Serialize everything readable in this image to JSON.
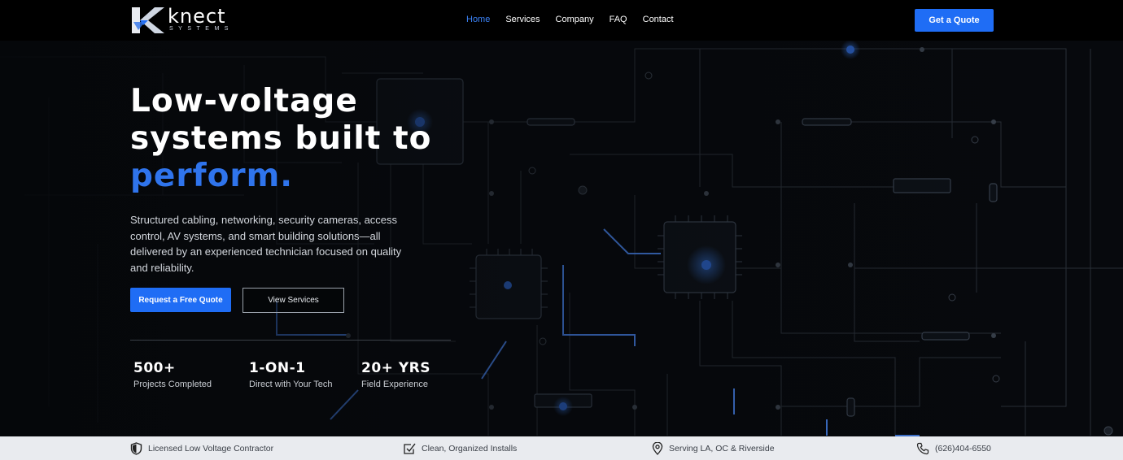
{
  "brand": {
    "name": "knect",
    "subtitle": "SYSTEMS"
  },
  "nav": {
    "items": [
      "Home",
      "Services",
      "Company",
      "FAQ",
      "Contact"
    ],
    "active_index": 0,
    "cta_label": "Get a Quote"
  },
  "hero": {
    "title_line1": "Low-voltage",
    "title_line2": "systems built to",
    "title_accent": "perform.",
    "description": "Structured cabling, networking, security cameras, access control, AV systems, and smart building solutions—all delivered by an experienced technician focused on quality and reliability.",
    "primary_button": "Request a Free Quote",
    "secondary_button": "View Services"
  },
  "stats": [
    {
      "value": "500+",
      "label": "Projects Completed"
    },
    {
      "value": "1-ON-1",
      "label": "Direct with Your Tech"
    },
    {
      "value": "20+ YRS",
      "label": "Field Experience"
    }
  ],
  "strip": [
    {
      "icon": "shield-icon",
      "label": "Licensed Low Voltage Contractor"
    },
    {
      "icon": "check-box-icon",
      "label": "Clean, Organized Installs"
    },
    {
      "icon": "location-pin-icon",
      "label": "Serving LA, OC & Riverside"
    },
    {
      "icon": "phone-icon",
      "label": "(626)404-6550"
    }
  ],
  "colors": {
    "accent": "#1f6df5",
    "accent_text": "#2f74ec",
    "background": "#05070a",
    "strip": "#e9ebef"
  }
}
